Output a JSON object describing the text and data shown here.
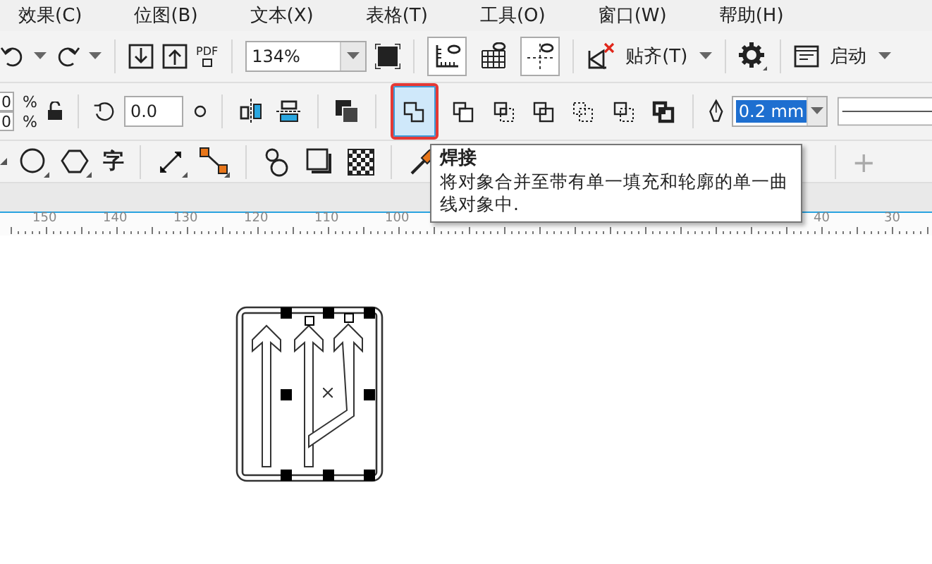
{
  "menu": [
    {
      "label": "效果(C)"
    },
    {
      "label": "位图(B)"
    },
    {
      "label": "文本(X)"
    },
    {
      "label": "表格(T)"
    },
    {
      "label": "工具(O)"
    },
    {
      "label": "窗口(W)"
    },
    {
      "label": "帮助(H)"
    }
  ],
  "standard_toolbar": [
    {
      "kind": "undo"
    },
    {
      "kind": "caret"
    },
    {
      "kind": "redo"
    },
    {
      "kind": "caret"
    },
    {
      "kind": "sep"
    },
    {
      "kind": "import"
    },
    {
      "kind": "export"
    },
    {
      "kind": "pdf",
      "label": "PDF"
    },
    {
      "kind": "sep"
    },
    {
      "kind": "zoom",
      "value": "134%"
    },
    {
      "kind": "fullscreen"
    },
    {
      "kind": "sep"
    },
    {
      "kind": "rulers",
      "selected": true
    },
    {
      "kind": "grid",
      "selected": false
    },
    {
      "kind": "guides",
      "selected": true
    },
    {
      "kind": "sep"
    },
    {
      "kind": "snapoff"
    },
    {
      "kind": "menu",
      "label": "贴齐(T)"
    },
    {
      "kind": "caret"
    },
    {
      "kind": "sep"
    },
    {
      "kind": "gear"
    },
    {
      "kind": "sep"
    },
    {
      "kind": "launch"
    },
    {
      "kind": "menu",
      "label": "启动"
    },
    {
      "kind": "caret"
    }
  ],
  "property_bar": {
    "scale": [
      {
        "value": "0",
        "unit": "%"
      },
      {
        "value": "0",
        "unit": "%"
      }
    ],
    "angle": "0.0",
    "shaping": [
      {
        "kind": "weld",
        "selected": true
      },
      {
        "kind": "trim",
        "selected": false
      },
      {
        "kind": "intersect",
        "selected": false
      },
      {
        "kind": "simplify",
        "selected": false
      },
      {
        "kind": "front",
        "selected": false
      },
      {
        "kind": "back",
        "selected": false
      },
      {
        "kind": "boundary",
        "selected": false
      }
    ],
    "outline_width": "0.2 mm"
  },
  "toolbox": [
    {
      "kind": "ellipse"
    },
    {
      "kind": "polygon"
    },
    {
      "kind": "text",
      "label": "字"
    },
    {
      "kind": "sep"
    },
    {
      "kind": "line"
    },
    {
      "kind": "connector"
    },
    {
      "kind": "sep"
    },
    {
      "kind": "blend"
    },
    {
      "kind": "shadow"
    },
    {
      "kind": "transparency"
    },
    {
      "kind": "sep"
    },
    {
      "kind": "eyedropper"
    }
  ],
  "add_button": "+",
  "ruler": {
    "left_labels": [
      "150",
      "140",
      "130",
      "120",
      "110",
      "100"
    ],
    "right_labels": [
      "40",
      "30"
    ]
  },
  "tooltip": {
    "title": "焊接",
    "text": "将对象合并至带有单一填充和轮廓的单一曲线对象中."
  }
}
